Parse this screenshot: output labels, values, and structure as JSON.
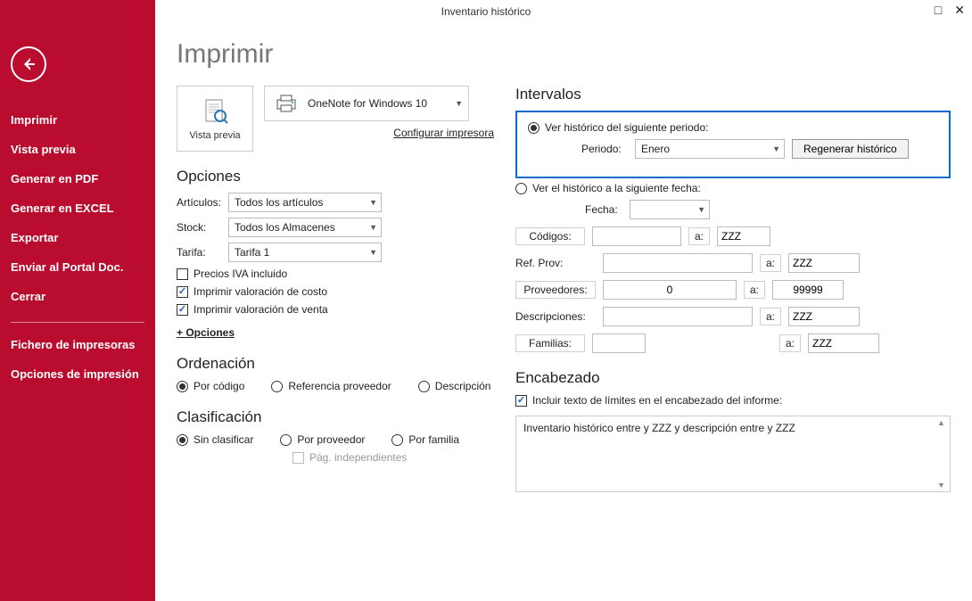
{
  "window": {
    "title": "Inventario histórico"
  },
  "sidebar": {
    "items": [
      {
        "label": "Imprimir"
      },
      {
        "label": "Vista previa"
      },
      {
        "label": "Generar en PDF"
      },
      {
        "label": "Generar en EXCEL"
      },
      {
        "label": "Exportar"
      },
      {
        "label": "Enviar al Portal Doc."
      },
      {
        "label": "Cerrar"
      }
    ],
    "secondary": [
      {
        "label": "Fichero de impresoras"
      },
      {
        "label": "Opciones de impresión"
      }
    ]
  },
  "page": {
    "title": "Imprimir",
    "preview_label": "Vista previa",
    "printer_name": "OneNote for Windows 10",
    "configure_printer": "Configurar impresora"
  },
  "options": {
    "heading": "Opciones",
    "articulos_label": "Artículos:",
    "articulos_value": "Todos los artículos",
    "stock_label": "Stock:",
    "stock_value": "Todos los Almacenes",
    "tarifa_label": "Tarifa:",
    "tarifa_value": "Tarifa 1",
    "chk_iva": "Precios IVA incluido",
    "chk_costo": "Imprimir valoración de costo",
    "chk_venta": "Imprimir valoración de venta",
    "more": "+ Opciones"
  },
  "order": {
    "heading": "Ordenación",
    "r1": "Por código",
    "r2": "Referencia proveedor",
    "r3": "Descripción"
  },
  "class": {
    "heading": "Clasificación",
    "r1": "Sin clasificar",
    "r2": "Por proveedor",
    "r3": "Por familia",
    "sub": "Pág. independientes"
  },
  "intervals": {
    "heading": "Intervalos",
    "radio_periodo": "Ver histórico del siguiente periodo:",
    "periodo_label": "Periodo:",
    "periodo_value": "Enero",
    "regen_btn": "Regenerar histórico",
    "radio_fecha": "Ver el histórico a la siguiente fecha:",
    "fecha_label": "Fecha:",
    "codigos_label": "Códigos:",
    "a": "a:",
    "codigos_to": "ZZZ",
    "refprov_label": "Ref. Prov:",
    "refprov_to": "ZZZ",
    "prov_label": "Proveedores:",
    "prov_from": "0",
    "prov_to": "99999",
    "desc_label": "Descripciones:",
    "desc_to": "ZZZ",
    "fam_label": "Familias:",
    "fam_to": "ZZZ"
  },
  "header": {
    "heading": "Encabezado",
    "chk": "Incluir texto de límites en el encabezado del informe:",
    "text": "Inventario histórico entre  y ZZZ y descripción entre  y ZZZ"
  }
}
